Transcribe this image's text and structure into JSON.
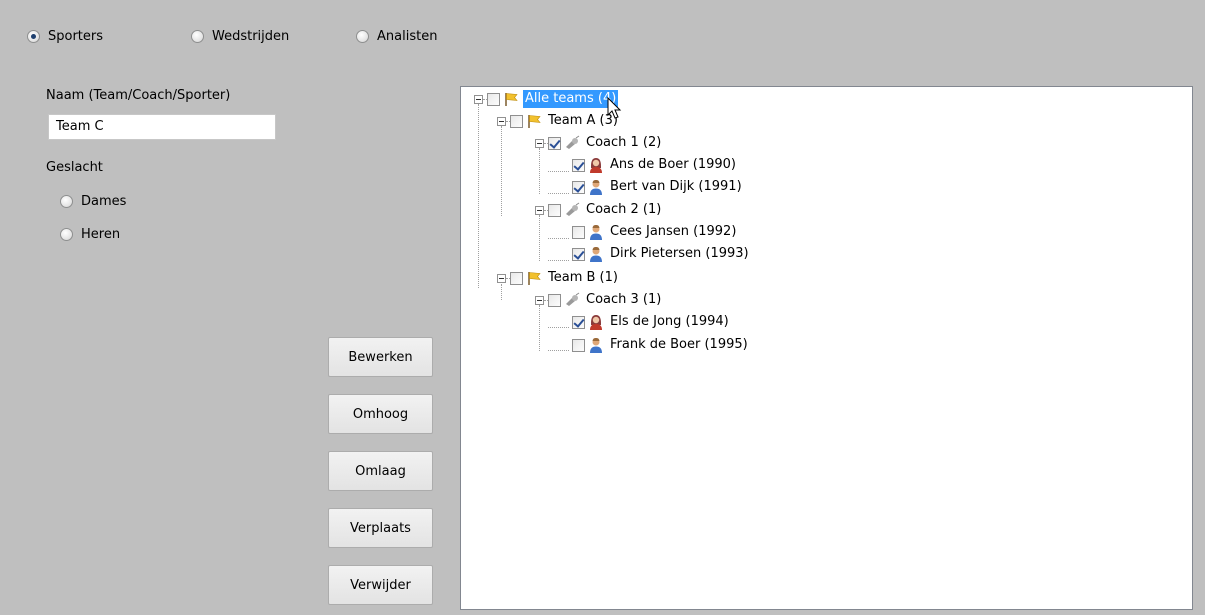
{
  "mode_radios": [
    {
      "label": "Sporters",
      "selected": true
    },
    {
      "label": "Wedstrijden",
      "selected": false
    },
    {
      "label": "Analisten",
      "selected": false
    }
  ],
  "form": {
    "name_label": "Naam (Team/Coach/Sporter)",
    "name_value": "Team C",
    "gender_label": "Geslacht",
    "gender_options": [
      {
        "label": "Dames",
        "selected": false
      },
      {
        "label": "Heren",
        "selected": false
      }
    ]
  },
  "buttons": {
    "edit": "Bewerken",
    "up": "Omhoog",
    "down": "Omlaag",
    "move": "Verplaats",
    "delete": "Verwijder"
  },
  "tree": {
    "nodes": [
      {
        "label": "Alle teams (4)",
        "icon": "flag-icon",
        "checked": false,
        "selected": true
      },
      {
        "label": "Team A (3)",
        "icon": "flag-icon",
        "checked": false
      },
      {
        "label": "Coach 1 (2)",
        "icon": "whistle-icon",
        "checked": true
      },
      {
        "label": "Ans de Boer (1990)",
        "icon": "female-user-icon",
        "checked": true
      },
      {
        "label": "Bert van Dijk (1991)",
        "icon": "male-user-icon",
        "checked": true
      },
      {
        "label": "Coach 2 (1)",
        "icon": "whistle-icon",
        "checked": false
      },
      {
        "label": "Cees Jansen (1992)",
        "icon": "male-user-icon",
        "checked": false
      },
      {
        "label": "Dirk Pietersen (1993)",
        "icon": "male-user-icon",
        "checked": true
      },
      {
        "label": "Team B (1)",
        "icon": "flag-icon",
        "checked": false
      },
      {
        "label": "Coach 3 (1)",
        "icon": "whistle-icon",
        "checked": false
      },
      {
        "label": "Els de Jong (1994)",
        "icon": "female-user-icon",
        "checked": true
      },
      {
        "label": "Frank de Boer (1995)",
        "icon": "male-user-icon",
        "checked": false
      }
    ]
  },
  "colors": {
    "background": "#bfbfbf",
    "selection": "#3399ff",
    "check": "#2a4f96"
  }
}
